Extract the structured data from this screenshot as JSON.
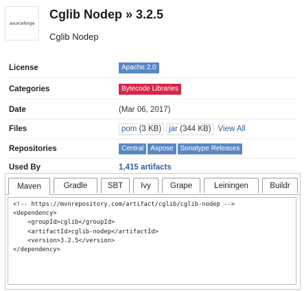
{
  "header": {
    "logo_text": "sourceforge",
    "title": "Cglib Nodep » 3.2.5",
    "subtitle": "Cglib Nodep"
  },
  "details": {
    "license": {
      "label": "License",
      "badge": "Apache 2.0"
    },
    "categories": {
      "label": "Categories",
      "badge": "Bytecode Libraries"
    },
    "date": {
      "label": "Date",
      "value": "(Mar 06, 2017)"
    },
    "files": {
      "label": "Files",
      "pom_label": "pom",
      "pom_size": "(3 KB)",
      "jar_label": "jar",
      "jar_size": "(344 KB)",
      "view_all": "View All"
    },
    "repositories": {
      "label": "Repositories",
      "items": [
        "Central",
        "Aspose",
        "Sonatype Releases"
      ]
    },
    "used_by": {
      "label": "Used By",
      "value": "1,415 artifacts"
    }
  },
  "tabs": {
    "items": [
      "Maven",
      "Gradle",
      "SBT",
      "Ivy",
      "Grape",
      "Leiningen",
      "Buildr"
    ],
    "active": "Maven",
    "code": "<!-- https://mvnrepository.com/artifact/cglib/cglib-nodep -->\n<dependency>\n    <groupId>cglib</groupId>\n    <artifactId>cglib-nodep</artifactId>\n    <version>3.2.5</version>\n</dependency>"
  },
  "colors": {
    "license_badge": "#5b88c4",
    "category_badge": "#d9254a",
    "repo_badge": "#5b88c4",
    "link": "#2b5fa6"
  }
}
